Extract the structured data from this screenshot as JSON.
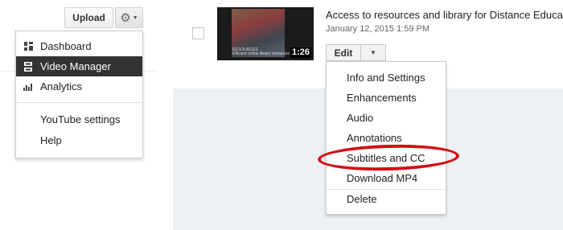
{
  "header": {
    "upload_label": "Upload",
    "settings_icon": "gear-icon"
  },
  "account_menu": {
    "items": [
      {
        "label": "Dashboard",
        "icon": "dashboard-icon",
        "active": false
      },
      {
        "label": "Video Manager",
        "icon": "video-manager-icon",
        "active": true
      },
      {
        "label": "Analytics",
        "icon": "analytics-icon",
        "active": false
      }
    ],
    "secondary_items": [
      {
        "label": "YouTube settings"
      },
      {
        "label": "Help"
      }
    ]
  },
  "video": {
    "title": "Access to resources and library for Distance Educa",
    "date": "January 12, 2015 1:59 PM",
    "duration": "1:26",
    "thumbnail_caption_line1": "RESOURCES",
    "thumbnail_caption_line2": "Efficient online library resources"
  },
  "edit_menu": {
    "button_label": "Edit",
    "items": [
      {
        "label": "Info and Settings"
      },
      {
        "label": "Enhancements"
      },
      {
        "label": "Audio"
      },
      {
        "label": "Annotations"
      },
      {
        "label": "Subtitles and CC",
        "highlighted": true
      },
      {
        "label": "Download MP4"
      }
    ],
    "footer_item": {
      "label": "Delete"
    }
  },
  "colors": {
    "highlight_ring": "#d20f16",
    "active_menu_bg": "#333333"
  }
}
